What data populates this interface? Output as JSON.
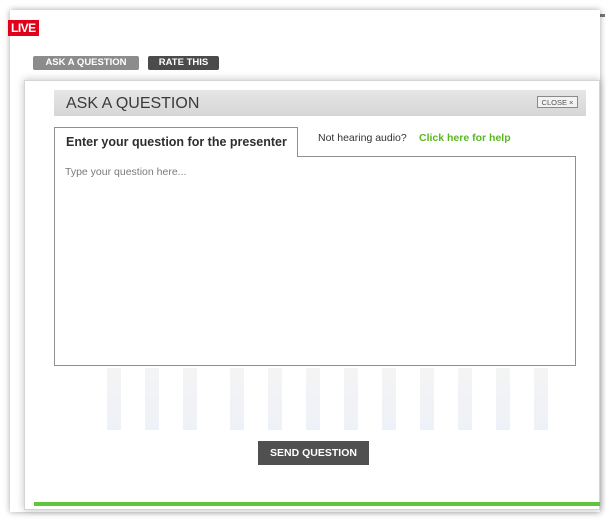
{
  "live_label": "LIVE",
  "tabs": {
    "ask": "ASK A QUESTION",
    "rate": "RATE THIS"
  },
  "modal": {
    "title": "ASK A QUESTION",
    "close_label": "CLOSE ×",
    "question_tab": "Enter your question for the presenter",
    "audio_prompt": "Not hearing audio?",
    "audio_help_link": "Click here for help",
    "textarea_placeholder": "Type your question here...",
    "send_button": "SEND QUESTION"
  },
  "colors": {
    "live": "#e1001a",
    "accent_green": "#5ec53c",
    "link_green": "#5bb823",
    "dark_button": "#505050"
  }
}
